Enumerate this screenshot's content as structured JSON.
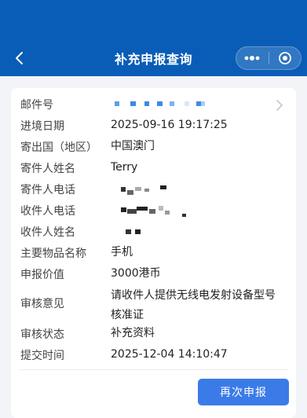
{
  "header": {
    "title": "补充申报查询"
  },
  "colors": {
    "header_bg": "#0a5db7",
    "button_bg": "#3b7be8",
    "mask_blue": "#5b9ee9"
  },
  "icons": {
    "back": "chevron-left-icon",
    "more": "more-dots-icon",
    "close": "target-circle-icon",
    "detail": "chevron-right-icon"
  },
  "details": {
    "tracking_number": {
      "label": "邮件号",
      "value": ""
    },
    "progress_date": {
      "label": "进境日期",
      "value": "2025-09-16 19:17:25"
    },
    "origin_country": {
      "label": "寄出国（地区）",
      "value": "中国澳门"
    },
    "sender_name": {
      "label": "寄件人姓名",
      "value": "Terry"
    },
    "sender_phone": {
      "label": "寄件人电话",
      "value": ""
    },
    "recipient_phone": {
      "label": "收件人电话",
      "value": ""
    },
    "recipient_name": {
      "label": "收件人姓名",
      "value": ""
    },
    "item_name": {
      "label": "主要物品名称",
      "value": "手机"
    },
    "declared_value": {
      "label": "申报价值",
      "value": "3000港币"
    },
    "review_comment": {
      "label": "审核意见",
      "value": "请收件人提供无线电发射设备型号核准证"
    },
    "review_status": {
      "label": "审核状态",
      "value": "补充资料"
    },
    "submit_time": {
      "label": "提交时间",
      "value": "2025-12-04 14:10:47"
    }
  },
  "actions": {
    "resubmit_label": "再次申报"
  }
}
